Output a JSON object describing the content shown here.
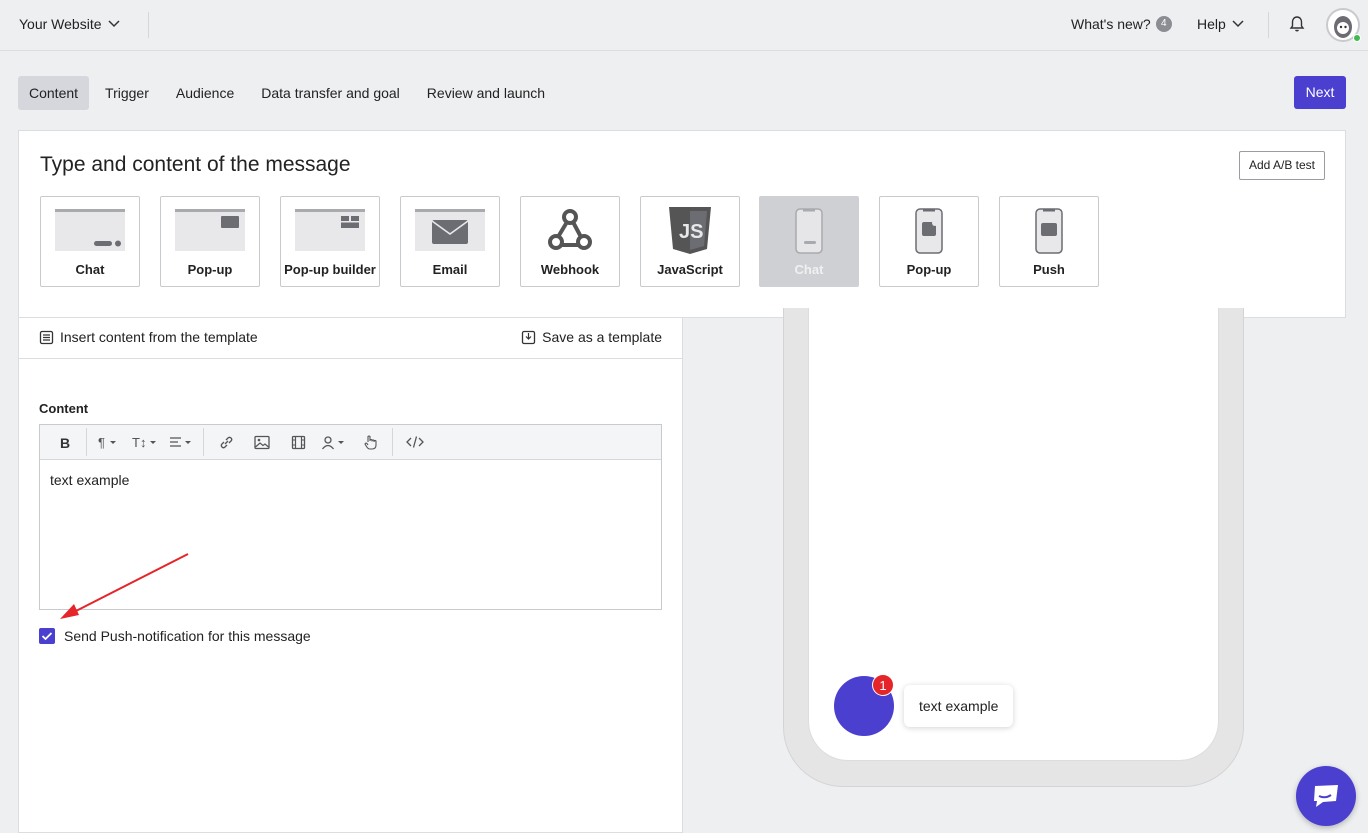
{
  "topbar": {
    "site_name": "Your Website",
    "whats_new_label": "What's new?",
    "whats_new_count": "4",
    "help_label": "Help"
  },
  "tabs": [
    {
      "label": "Content",
      "active": true
    },
    {
      "label": "Trigger"
    },
    {
      "label": "Audience"
    },
    {
      "label": "Data transfer and goal"
    },
    {
      "label": "Review and launch"
    }
  ],
  "next_label": "Next",
  "type_section": {
    "title": "Type and content of the message",
    "ab_test_label": "Add A/B test",
    "types": [
      {
        "label": "Chat",
        "icon": "desktop-chat-icon"
      },
      {
        "label": "Pop-up",
        "icon": "desktop-popup-icon"
      },
      {
        "label": "Pop-up builder",
        "icon": "popup-builder-icon"
      },
      {
        "label": "Email",
        "icon": "email-icon"
      },
      {
        "label": "Webhook",
        "icon": "webhook-icon"
      },
      {
        "label": "JavaScript",
        "icon": "javascript-icon"
      },
      {
        "label": "Chat",
        "icon": "mobile-chat-icon",
        "disabled": true
      },
      {
        "label": "Pop-up",
        "icon": "mobile-popup-icon"
      },
      {
        "label": "Push",
        "icon": "mobile-push-icon"
      }
    ]
  },
  "template_bar": {
    "insert_label": "Insert content from the template",
    "save_label": "Save as a template"
  },
  "content": {
    "label": "Content",
    "text": "text example",
    "push_checkbox_label": "Send Push-notification for this message",
    "push_checked": true
  },
  "preview": {
    "badge_count": "1",
    "message": "text example"
  },
  "colors": {
    "accent": "#4a3fce",
    "badge_red": "#e5252a",
    "annotation_arrow": "#e5252a"
  }
}
